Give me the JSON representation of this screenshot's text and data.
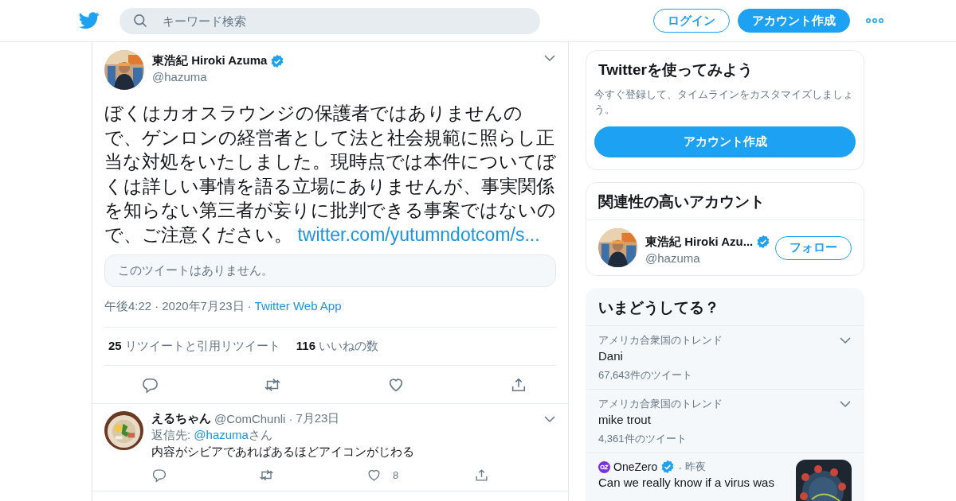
{
  "header": {
    "search": {
      "placeholder": "キーワード検索"
    },
    "buttons": [
      {
        "kind": "outline",
        "label": "ログイン"
      },
      {
        "kind": "filled",
        "label": "アカウント作成"
      }
    ]
  },
  "tweet": {
    "name": "東浩紀 Hiroki Azuma",
    "verified": true,
    "handle": "@hazuma",
    "text": "ぼくはカオスラウンジの保護者ではありませんので、ゲンロンの経営者として法と社会規範に照らし正当な対処をいたしました。現時点では本件についてぼくは詳しい事情を語る立場にありませんが、事実関係を知らない第三者が妄りに批判できる事案ではないので、ご注意ください。",
    "link": "twitter.com/yutumndotcom/s...",
    "quote": "このツイートはありません。",
    "separator": "·",
    "time": "午後4:22",
    "date": "2020年7月23日",
    "source": "Twitter Web App",
    "stats": [
      {
        "count": "25",
        "label": "リツイートと引用リツイート"
      },
      {
        "count": "116",
        "label": "いいねの数"
      }
    ]
  },
  "reply": {
    "name": "えるちゃん",
    "handle": "@ComChunli",
    "separator": "·",
    "date": "7月23日",
    "reply_to_label": "返信先:",
    "reply_to_handle": "@hazuma",
    "reply_to_suffix": "さん",
    "text": "内容がシビアであればあるほどアイコンがじわる",
    "like_count": "8"
  },
  "sidebar": {
    "signup": {
      "title": "Twitterを使ってみよう",
      "description": "今すぐ登録して、タイムラインをカスタマイズしましょう。",
      "button": "アカウント作成"
    },
    "related": {
      "title": "関連性の高いアカウント",
      "account": {
        "name": "東浩紀 Hiroki Azu...",
        "verified": true,
        "handle": "@hazuma",
        "button": "フォロー"
      }
    },
    "trends": {
      "title": "いまどうしてる？",
      "items": [
        {
          "kind": "trend",
          "context": "アメリカ合衆国のトレンド",
          "name": "Dani",
          "count": "67,643件のツイート"
        },
        {
          "kind": "trend",
          "context": "アメリカ合衆国のトレンド",
          "name": "mike trout",
          "count": "4,361件のツイート"
        },
        {
          "kind": "news",
          "source": "OneZero",
          "verified": true,
          "separator": "·",
          "time": "昨夜",
          "headline": "Can we really know if a virus was"
        }
      ]
    }
  }
}
